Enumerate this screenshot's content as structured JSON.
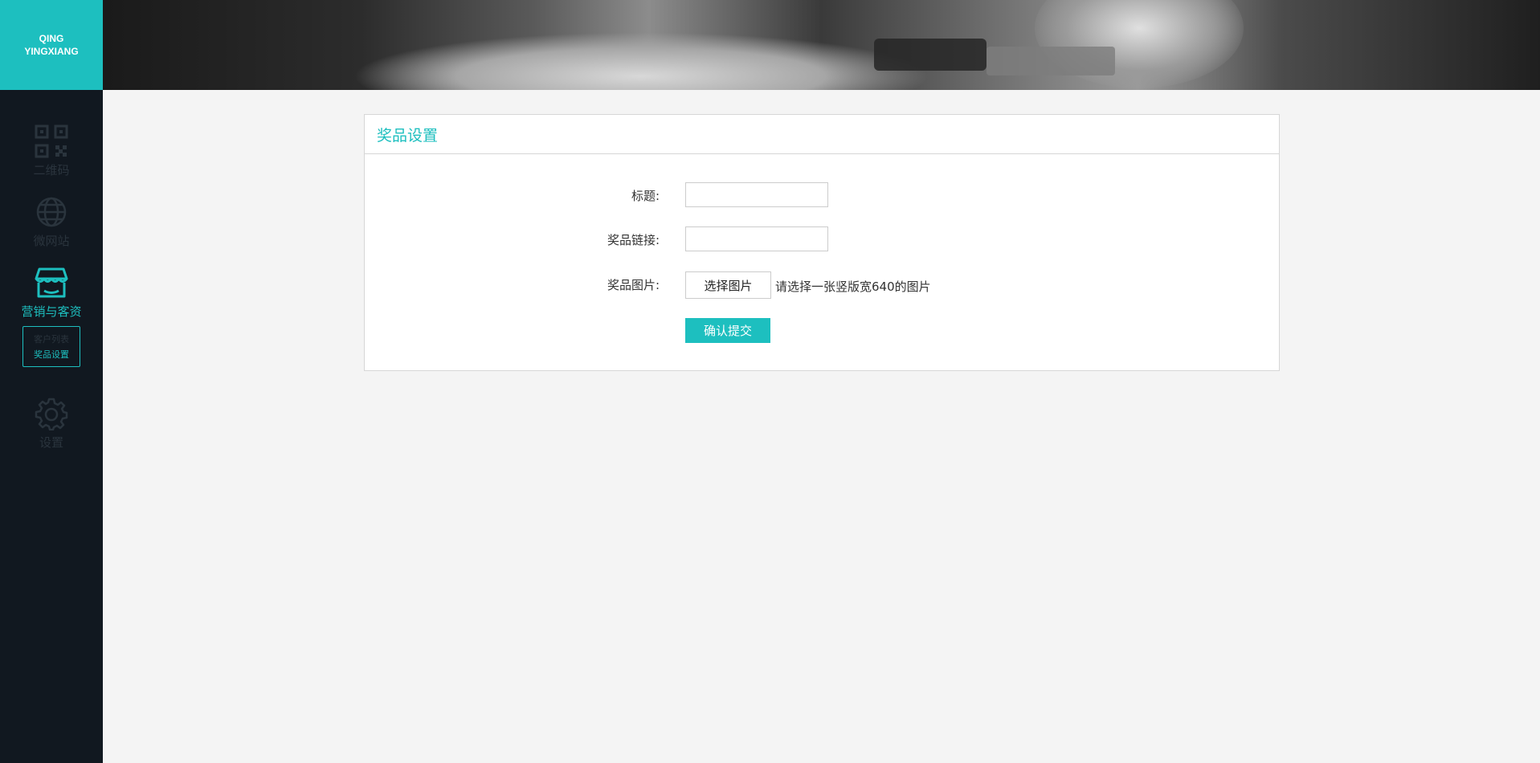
{
  "logo": {
    "line1": "QING",
    "line2": "YINGXIANG"
  },
  "sidebar": {
    "items": [
      {
        "label": "二维码",
        "icon": "qrcode-icon",
        "active": false
      },
      {
        "label": "微网站",
        "icon": "globe-icon",
        "active": false
      },
      {
        "label": "营销与客资",
        "icon": "store-icon",
        "active": true
      },
      {
        "label": "设置",
        "icon": "gear-icon",
        "active": false
      }
    ],
    "subitems": [
      {
        "label": "客户列表",
        "active": false
      },
      {
        "label": "奖品设置",
        "active": true
      }
    ]
  },
  "panel": {
    "title": "奖品设置",
    "fields": {
      "title_label": "标题:",
      "title_value": "",
      "link_label": "奖品链接:",
      "link_value": "",
      "image_label": "奖品图片:",
      "image_button": "选择图片",
      "image_hint": "请选择一张竖版宽640的图片"
    },
    "submit_label": "确认提交"
  },
  "colors": {
    "accent": "#1dbfbf",
    "sidebar_bg": "#111820",
    "sidebar_inactive": "#2a343d",
    "page_bg": "#f4f4f4"
  }
}
